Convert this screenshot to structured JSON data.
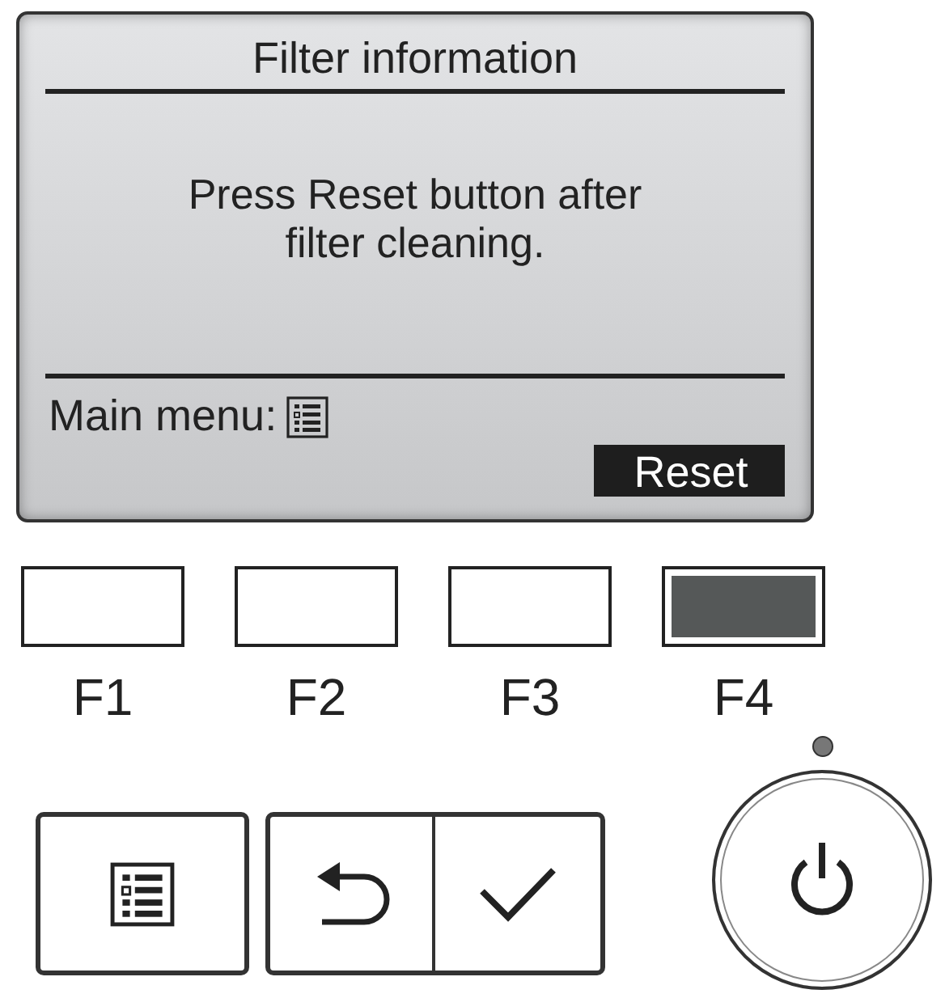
{
  "screen": {
    "title": "Filter information",
    "message": "Press Reset button after filter cleaning.",
    "footer_label": "Main menu:",
    "soft_key": "Reset"
  },
  "function_keys": [
    {
      "label": "F1",
      "selected": false
    },
    {
      "label": "F2",
      "selected": false
    },
    {
      "label": "F3",
      "selected": false
    },
    {
      "label": "F4",
      "selected": true
    }
  ],
  "control_buttons": [
    {
      "kind": "menu"
    },
    {
      "kind": "back"
    },
    {
      "kind": "confirm"
    }
  ],
  "power": {
    "led_on": false
  }
}
